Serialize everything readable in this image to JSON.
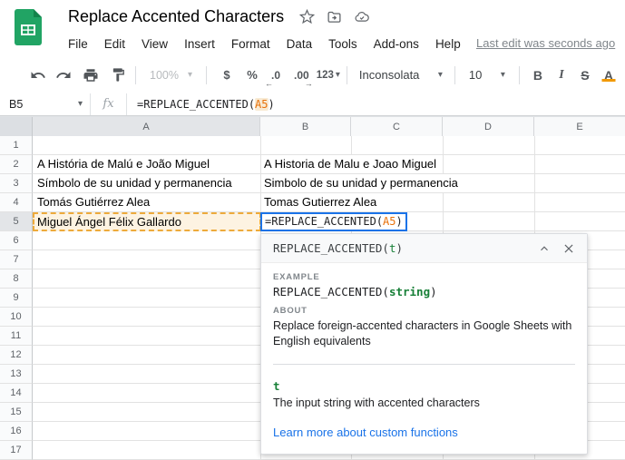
{
  "header": {
    "title": "Replace Accented Characters",
    "menus": [
      "File",
      "Edit",
      "View",
      "Insert",
      "Format",
      "Data",
      "Tools",
      "Add-ons",
      "Help"
    ],
    "last_edit": "Last edit was seconds ago"
  },
  "toolbar": {
    "zoom": "100%",
    "labels": {
      "currency": "$",
      "percent": "%",
      "decrease_decimal": ".0",
      "increase_decimal": ".00",
      "more_formats": "123",
      "bold": "B",
      "italic": "I",
      "strikethrough": "S",
      "text_color": "A"
    },
    "font_name": "Inconsolata",
    "font_size": "10"
  },
  "formula_bar": {
    "cell_ref": "B5",
    "fx_label": "fx",
    "formula_prefix": "=REPLACE_ACCENTED(",
    "formula_range": "A5",
    "formula_suffix": ")"
  },
  "grid": {
    "columns": [
      "A",
      "B",
      "C",
      "D",
      "E"
    ],
    "row_labels": [
      "1",
      "2",
      "3",
      "4",
      "5",
      "6",
      "7",
      "8",
      "9",
      "10",
      "11",
      "12",
      "13",
      "14",
      "15",
      "16",
      "17"
    ],
    "cells": {
      "a2": "A História de Malú e João Miguel",
      "b2": "A Historia de Malu e Joao Miguel",
      "a3": "Símbolo de su unidad y permanencia",
      "b3": "Simbolo de su unidad y permanencia",
      "a4": "Tomás Gutiérrez Alea",
      "b4": "Tomas Gutierrez Alea",
      "a5": "Miguel Ángel Félix Gallardo",
      "b5_prefix": "=REPLACE_ACCENTED(",
      "b5_range": "A5",
      "b5_suffix": ")"
    }
  },
  "popup": {
    "header_fn": "REPLACE_ACCENTED(",
    "header_param": "t",
    "header_close": ")",
    "example_label": "EXAMPLE",
    "example_fn": "REPLACE_ACCENTED(",
    "example_param": "string",
    "example_close": ")",
    "about_label": "ABOUT",
    "about_text": "Replace foreign-accented characters in Google Sheets with English equivalents",
    "param_name": "t",
    "param_desc": "The input string with accented characters",
    "link_text": "Learn more about custom functions"
  },
  "icons": {
    "sheets-logo": "green document with grid",
    "star-icon": "outline star",
    "move-folder-icon": "folder with arrow",
    "cloud-check-icon": "cloud with checkmark",
    "undo-icon": "curved arrow left",
    "redo-icon": "curved arrow right",
    "print-icon": "printer",
    "paint-format-icon": "paint roller",
    "caret-down-icon": "▾",
    "decrease-decimal-arrow": "←",
    "increase-decimal-arrow": "→",
    "fx-icon": "italic fx",
    "caret-up-icon": "chevron up",
    "close-icon": "✕"
  },
  "colors": {
    "accent_blue": "#1a73e8",
    "function_green": "#188038",
    "range_orange": "#e8710a",
    "range_highlight_border": "#edaa3b",
    "range_highlight_fill": "#fdf3e2",
    "logo_green": "#21a464",
    "text_color_underline": "#f29900"
  }
}
